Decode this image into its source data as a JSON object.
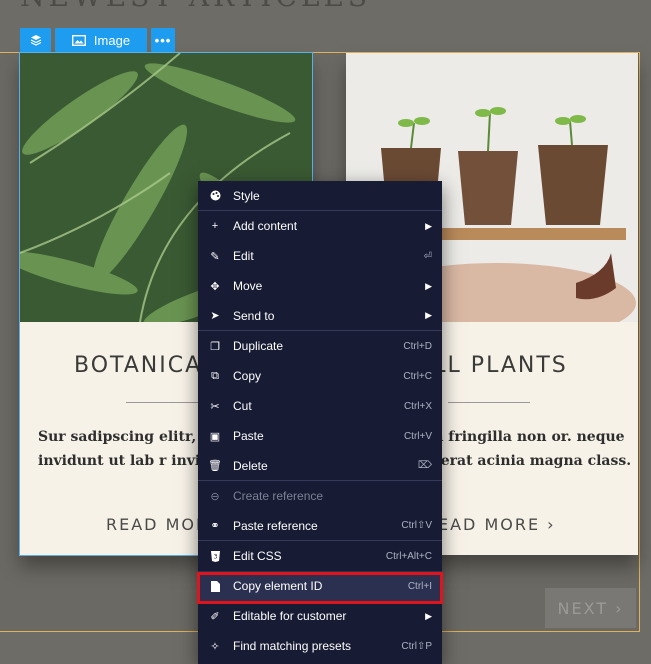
{
  "page": {
    "heading": "NEWEST ARTICLES"
  },
  "toolbar": {
    "image_label": "Image",
    "more_label": "•••"
  },
  "cards": [
    {
      "title": "BOTANICA",
      "text": "Sur sadipscing elitr, no tempor invidunt ut lab r invidunt u",
      "read_more": "READ MOR"
    },
    {
      "title": "ALL PLANTS",
      "text": "risus? Non fringilla non or. neque purus, placerat acinia magna class.",
      "read_more": "EAD MORE ›"
    }
  ],
  "next_button": "NEXT ›",
  "context_menu": {
    "items": [
      {
        "label": "Style",
        "icon": "palette-icon",
        "shortcut": "",
        "submenu": false,
        "disabled": false
      },
      {
        "label": "Add content",
        "icon": "plus-icon",
        "shortcut": "",
        "submenu": true,
        "disabled": false
      },
      {
        "label": "Edit",
        "icon": "pencil-icon",
        "shortcut": "⏎",
        "submenu": false,
        "disabled": false
      },
      {
        "label": "Move",
        "icon": "move-icon",
        "shortcut": "",
        "submenu": true,
        "disabled": false
      },
      {
        "label": "Send to",
        "icon": "send-icon",
        "shortcut": "",
        "submenu": true,
        "disabled": false
      },
      {
        "label": "Duplicate",
        "icon": "duplicate-icon",
        "shortcut": "Ctrl+D",
        "submenu": false,
        "disabled": false
      },
      {
        "label": "Copy",
        "icon": "copy-icon",
        "shortcut": "Ctrl+C",
        "submenu": false,
        "disabled": false
      },
      {
        "label": "Cut",
        "icon": "scissors-icon",
        "shortcut": "Ctrl+X",
        "submenu": false,
        "disabled": false
      },
      {
        "label": "Paste",
        "icon": "paste-icon",
        "shortcut": "Ctrl+V",
        "submenu": false,
        "disabled": false
      },
      {
        "label": "Delete",
        "icon": "trash-icon",
        "shortcut": "⌦",
        "submenu": false,
        "disabled": false
      },
      {
        "label": "Create reference",
        "icon": "link-icon",
        "shortcut": "",
        "submenu": false,
        "disabled": true
      },
      {
        "label": "Paste reference",
        "icon": "paste-reference-icon",
        "shortcut": "Ctrl⇧V",
        "submenu": false,
        "disabled": false
      },
      {
        "label": "Edit CSS",
        "icon": "css-icon",
        "shortcut": "Ctrl+Alt+C",
        "submenu": false,
        "disabled": false
      },
      {
        "label": "Copy element ID",
        "icon": "file-icon",
        "shortcut": "Ctrl+I",
        "submenu": false,
        "disabled": false
      },
      {
        "label": "Editable for customer",
        "icon": "edit-square-icon",
        "shortcut": "",
        "submenu": true,
        "disabled": false
      },
      {
        "label": "Find matching presets",
        "icon": "magic-wand-icon",
        "shortcut": "Ctrl⇧P",
        "submenu": false,
        "disabled": false
      }
    ]
  },
  "colors": {
    "accent": "#1e9df0",
    "menu_bg": "#171b33",
    "highlight_border": "#e0141c"
  }
}
